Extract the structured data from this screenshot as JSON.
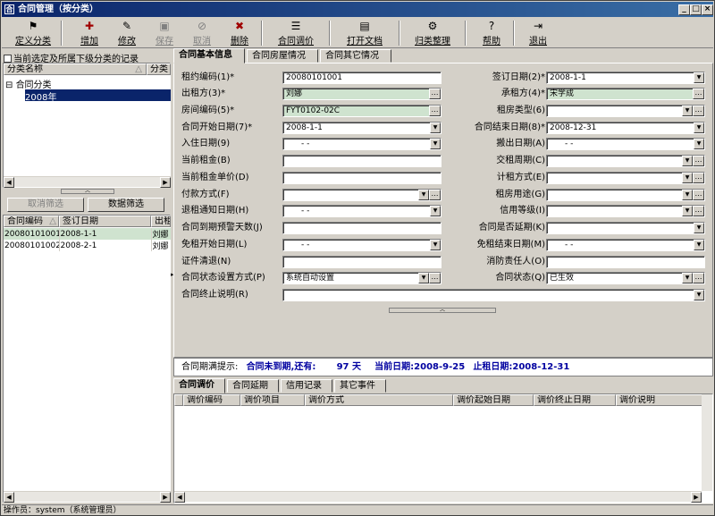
{
  "window": {
    "title": "合同管理（按分类）"
  },
  "toolbar": {
    "define_category": "定义分类",
    "add": "增加",
    "edit": "修改",
    "save": "保存",
    "cancel": "取消",
    "delete": "删除",
    "adjust_price": "合同调价",
    "open_doc": "打开文档",
    "archive": "归类整理",
    "help": "帮助",
    "exit": "退出"
  },
  "left": {
    "checkbox_label": "当前选定及所属下级分类的记录",
    "tree_headers": [
      "分类名称",
      "分类"
    ],
    "tree": {
      "root": "合同分类",
      "child": "2008年"
    },
    "btn_cancel_filter": "取消筛选",
    "btn_filter": "数据筛选",
    "list_headers": [
      "合同编码",
      "签订日期",
      "出租"
    ],
    "rows": [
      [
        "20080101001",
        "2008-1-1",
        "刘娜"
      ],
      [
        "20080101002",
        "2008-2-1",
        "刘娜"
      ]
    ]
  },
  "tabs": {
    "basic": "合同基本信息",
    "house": "合同房屋情况",
    "other": "合同其它情况"
  },
  "form": {
    "contract_no_l": "租约编码(1)*",
    "contract_no": "20080101001",
    "sign_date_l": "签订日期(2)*",
    "sign_date": "2008-1-1",
    "lessor_l": "出租方(3)*",
    "lessor": "刘娜",
    "lessee_l": "承租方(4)*",
    "lessee": "宋学成",
    "house_no_l": "房间编码(5)*",
    "house_no": "FYT0102-02C",
    "rent_type_l": "租房类型(6)",
    "rent_type": "",
    "start_l": "合同开始日期(7)*",
    "start": "2008-1-1",
    "end_l": "合同结束日期(8)*",
    "end": "2008-12-31",
    "movein_l": "入住日期(9)",
    "movein": "-  -",
    "moveout_l": "搬出日期(A)",
    "moveout": "-  -",
    "rent_l": "当前租金(B)",
    "rent": "",
    "paycycle_l": "交租周期(C)",
    "paycycle": "",
    "unitprice_l": "当前租金单价(D)",
    "unitprice": "",
    "billing_l": "计租方式(E)",
    "billing": "",
    "payway_l": "付款方式(F)",
    "payway": "",
    "usage_l": "租房用途(G)",
    "usage": "",
    "notice_l": "退租通知日期(H)",
    "notice": "-  -",
    "credit_l": "信用等级(I)",
    "credit": "",
    "warndays_l": "合同到期预警天数(J)",
    "warndays": "",
    "extended_l": "合同是否延期(K)",
    "extended": "",
    "freestart_l": "免租开始日期(L)",
    "freestart": "-  -",
    "freeend_l": "免租结束日期(M)",
    "freeend": "-  -",
    "cert_l": "证件清退(N)",
    "cert": "",
    "fire_l": "消防责任人(O)",
    "fire": "",
    "statusmode_l": "合同状态设置方式(P)",
    "statusmode": "系统自动设置",
    "status_l": "合同状态(Q)",
    "status": "已生效",
    "termnote_l": "合同终止说明(R)",
    "termnote": ""
  },
  "note": {
    "label": "合同期满提示:",
    "text": "合同未到期,还有:",
    "days": "97 天",
    "cur_l": "当前日期:",
    "cur": "2008-9-25",
    "end_l": "止租日期:",
    "end": "2008-12-31"
  },
  "tabs2": {
    "adjust": "合同调价",
    "extend": "合同延期",
    "credit": "信用记录",
    "other": "其它事件"
  },
  "table2": {
    "headers": [
      "调价编码",
      "调价项目",
      "调价方式",
      "调价起始日期",
      "调价终止日期",
      "调价说明"
    ]
  },
  "status": {
    "text": "操作员：system（系统管理员）"
  }
}
